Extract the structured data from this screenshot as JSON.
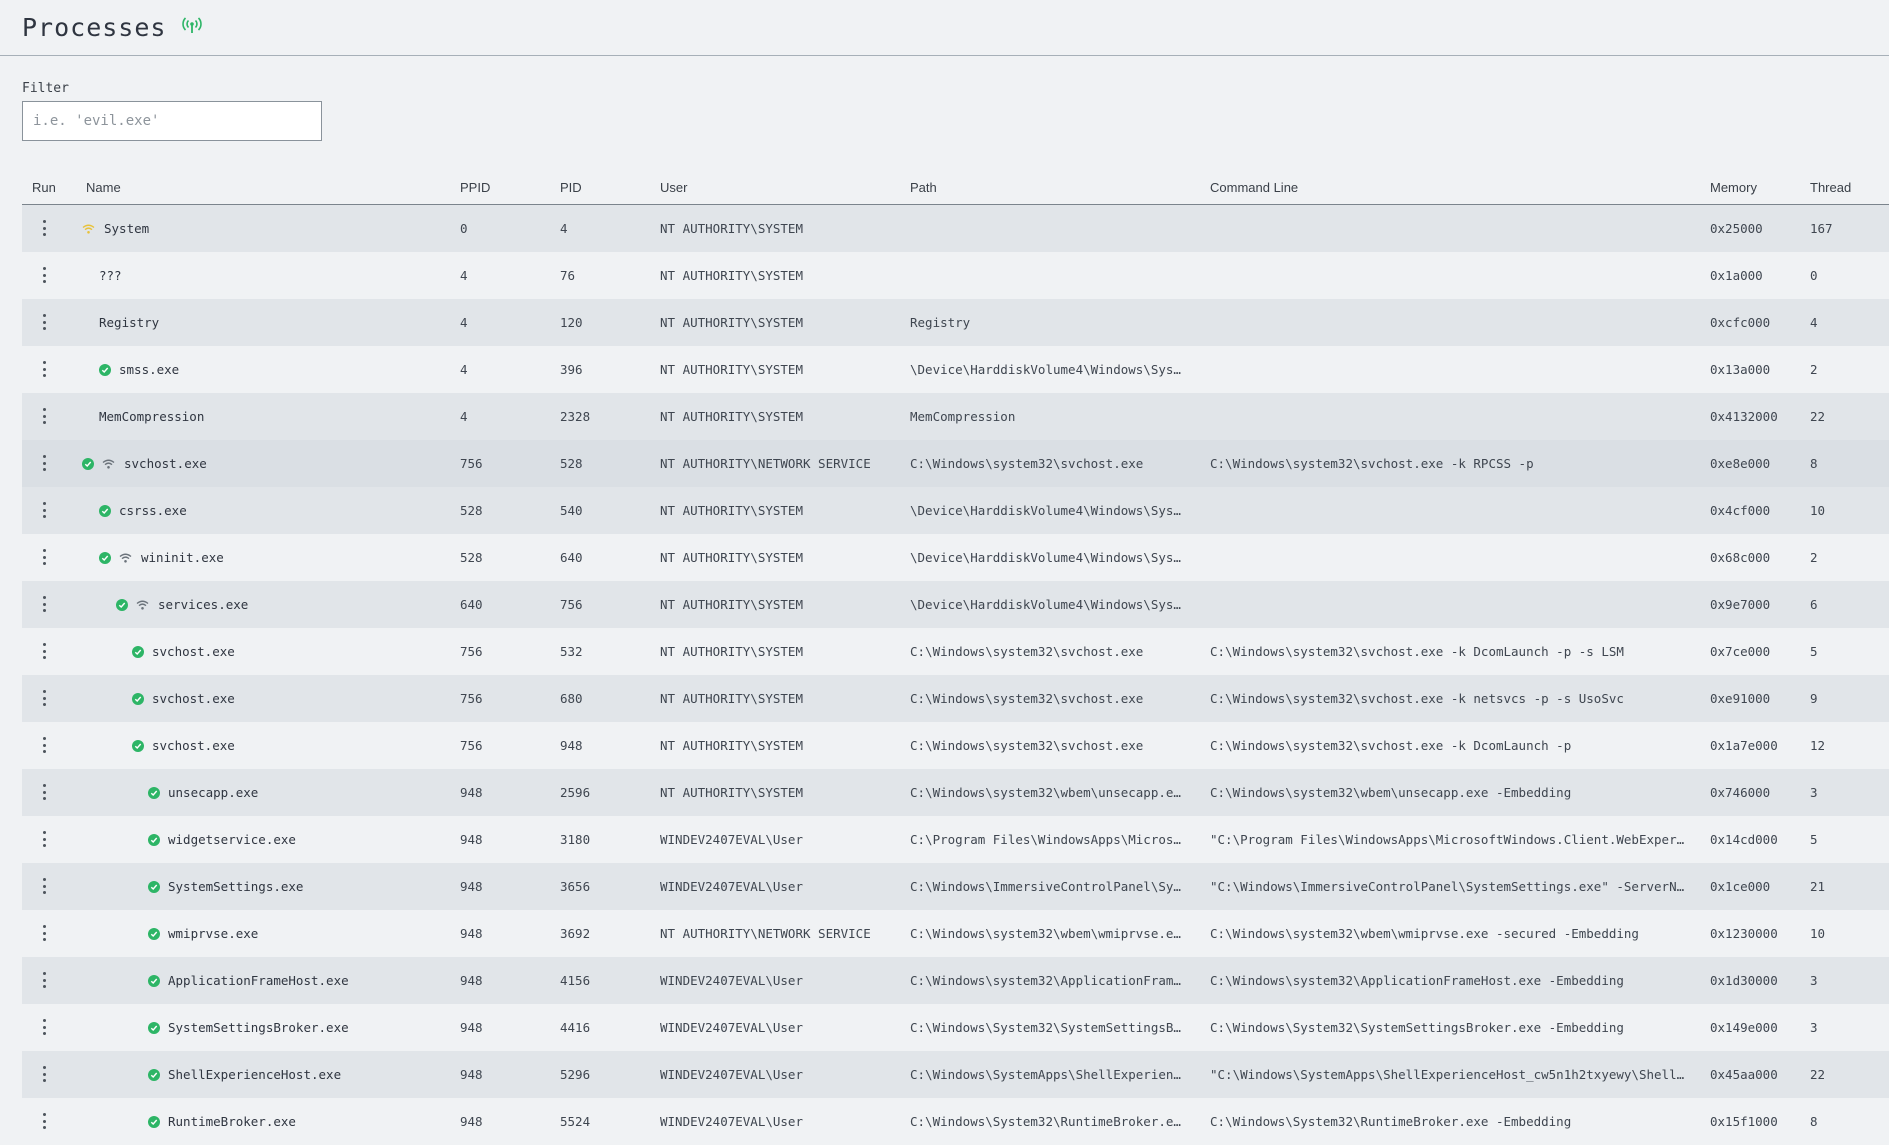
{
  "header": {
    "title": "Processes",
    "live_icon": "broadcast-icon",
    "accent": "#2db566"
  },
  "filter": {
    "label": "Filter",
    "placeholder": "i.e. 'evil.exe'",
    "value": ""
  },
  "table": {
    "columns": {
      "run": "Run",
      "name": "Name",
      "ppid": "PPID",
      "pid": "PID",
      "user": "User",
      "path": "Path",
      "cmd": "Command Line",
      "memory": "Memory",
      "thread": "Thread"
    },
    "rows": [
      {
        "name": "System",
        "level": 0,
        "check": false,
        "net": "yellow",
        "ppid": "0",
        "pid": "4",
        "user": "NT AUTHORITY\\SYSTEM",
        "path": "",
        "cmd": "",
        "memory": "0x25000",
        "thread": "167"
      },
      {
        "name": "???",
        "level": 1,
        "check": false,
        "net": null,
        "ppid": "4",
        "pid": "76",
        "user": "NT AUTHORITY\\SYSTEM",
        "path": "",
        "cmd": "",
        "memory": "0x1a000",
        "thread": "0"
      },
      {
        "name": "Registry",
        "level": 1,
        "check": false,
        "net": null,
        "ppid": "4",
        "pid": "120",
        "user": "NT AUTHORITY\\SYSTEM",
        "path": "Registry",
        "cmd": "",
        "memory": "0xcfc000",
        "thread": "4"
      },
      {
        "name": "smss.exe",
        "level": 1,
        "check": true,
        "net": null,
        "ppid": "4",
        "pid": "396",
        "user": "NT AUTHORITY\\SYSTEM",
        "path": "\\Device\\HarddiskVolume4\\Windows\\Sys…",
        "cmd": "",
        "memory": "0x13a000",
        "thread": "2"
      },
      {
        "name": "MemCompression",
        "level": 1,
        "check": false,
        "net": null,
        "ppid": "4",
        "pid": "2328",
        "user": "NT AUTHORITY\\SYSTEM",
        "path": "MemCompression",
        "cmd": "",
        "memory": "0x4132000",
        "thread": "22"
      },
      {
        "name": "svchost.exe",
        "level": 0,
        "check": true,
        "net": "gray",
        "selected": true,
        "ppid": "756",
        "pid": "528",
        "user": "NT AUTHORITY\\NETWORK SERVICE",
        "path": "C:\\Windows\\system32\\svchost.exe",
        "cmd": "C:\\Windows\\system32\\svchost.exe -k RPCSS -p",
        "memory": "0xe8e000",
        "thread": "8"
      },
      {
        "name": "csrss.exe",
        "level": 1,
        "check": true,
        "net": null,
        "ppid": "528",
        "pid": "540",
        "user": "NT AUTHORITY\\SYSTEM",
        "path": "\\Device\\HarddiskVolume4\\Windows\\Sys…",
        "cmd": "",
        "memory": "0x4cf000",
        "thread": "10"
      },
      {
        "name": "wininit.exe",
        "level": 1,
        "check": true,
        "net": "gray",
        "ppid": "528",
        "pid": "640",
        "user": "NT AUTHORITY\\SYSTEM",
        "path": "\\Device\\HarddiskVolume4\\Windows\\Sys…",
        "cmd": "",
        "memory": "0x68c000",
        "thread": "2"
      },
      {
        "name": "services.exe",
        "level": 2,
        "check": true,
        "net": "gray",
        "ppid": "640",
        "pid": "756",
        "user": "NT AUTHORITY\\SYSTEM",
        "path": "\\Device\\HarddiskVolume4\\Windows\\Sys…",
        "cmd": "",
        "memory": "0x9e7000",
        "thread": "6"
      },
      {
        "name": "svchost.exe",
        "level": 3,
        "check": true,
        "net": null,
        "ppid": "756",
        "pid": "532",
        "user": "NT AUTHORITY\\SYSTEM",
        "path": "C:\\Windows\\system32\\svchost.exe",
        "cmd": "C:\\Windows\\system32\\svchost.exe -k DcomLaunch -p -s LSM",
        "memory": "0x7ce000",
        "thread": "5"
      },
      {
        "name": "svchost.exe",
        "level": 3,
        "check": true,
        "net": null,
        "ppid": "756",
        "pid": "680",
        "user": "NT AUTHORITY\\SYSTEM",
        "path": "C:\\Windows\\system32\\svchost.exe",
        "cmd": "C:\\Windows\\system32\\svchost.exe -k netsvcs -p -s UsoSvc",
        "memory": "0xe91000",
        "thread": "9"
      },
      {
        "name": "svchost.exe",
        "level": 3,
        "check": true,
        "net": null,
        "ppid": "756",
        "pid": "948",
        "user": "NT AUTHORITY\\SYSTEM",
        "path": "C:\\Windows\\system32\\svchost.exe",
        "cmd": "C:\\Windows\\system32\\svchost.exe -k DcomLaunch -p",
        "memory": "0x1a7e000",
        "thread": "12"
      },
      {
        "name": "unsecapp.exe",
        "level": 4,
        "check": true,
        "net": null,
        "ppid": "948",
        "pid": "2596",
        "user": "NT AUTHORITY\\SYSTEM",
        "path": "C:\\Windows\\system32\\wbem\\unsecapp.e…",
        "cmd": "C:\\Windows\\system32\\wbem\\unsecapp.exe -Embedding",
        "memory": "0x746000",
        "thread": "3"
      },
      {
        "name": "widgetservice.exe",
        "level": 4,
        "check": true,
        "net": null,
        "ppid": "948",
        "pid": "3180",
        "user": "WINDEV2407EVAL\\User",
        "path": "C:\\Program Files\\WindowsApps\\Micros…",
        "cmd": "\"C:\\Program Files\\WindowsApps\\MicrosoftWindows.Client.WebExper…",
        "memory": "0x14cd000",
        "thread": "5"
      },
      {
        "name": "SystemSettings.exe",
        "level": 4,
        "check": true,
        "net": null,
        "ppid": "948",
        "pid": "3656",
        "user": "WINDEV2407EVAL\\User",
        "path": "C:\\Windows\\ImmersiveControlPanel\\Sy…",
        "cmd": "\"C:\\Windows\\ImmersiveControlPanel\\SystemSettings.exe\" -ServerN…",
        "memory": "0x1ce000",
        "thread": "21"
      },
      {
        "name": "wmiprvse.exe",
        "level": 4,
        "check": true,
        "net": null,
        "ppid": "948",
        "pid": "3692",
        "user": "NT AUTHORITY\\NETWORK SERVICE",
        "path": "C:\\Windows\\system32\\wbem\\wmiprvse.e…",
        "cmd": "C:\\Windows\\system32\\wbem\\wmiprvse.exe -secured -Embedding",
        "memory": "0x1230000",
        "thread": "10"
      },
      {
        "name": "ApplicationFrameHost.exe",
        "level": 4,
        "check": true,
        "net": null,
        "ppid": "948",
        "pid": "4156",
        "user": "WINDEV2407EVAL\\User",
        "path": "C:\\Windows\\system32\\ApplicationFram…",
        "cmd": "C:\\Windows\\system32\\ApplicationFrameHost.exe -Embedding",
        "memory": "0x1d30000",
        "thread": "3"
      },
      {
        "name": "SystemSettingsBroker.exe",
        "level": 4,
        "check": true,
        "net": null,
        "ppid": "948",
        "pid": "4416",
        "user": "WINDEV2407EVAL\\User",
        "path": "C:\\Windows\\System32\\SystemSettingsB…",
        "cmd": "C:\\Windows\\System32\\SystemSettingsBroker.exe -Embedding",
        "memory": "0x149e000",
        "thread": "3"
      },
      {
        "name": "ShellExperienceHost.exe",
        "level": 4,
        "check": true,
        "net": null,
        "ppid": "948",
        "pid": "5296",
        "user": "WINDEV2407EVAL\\User",
        "path": "C:\\Windows\\SystemApps\\ShellExperien…",
        "cmd": "\"C:\\Windows\\SystemApps\\ShellExperienceHost_cw5n1h2txyewy\\Shell…",
        "memory": "0x45aa000",
        "thread": "22"
      },
      {
        "name": "RuntimeBroker.exe",
        "level": 4,
        "check": true,
        "net": null,
        "ppid": "948",
        "pid": "5524",
        "user": "WINDEV2407EVAL\\User",
        "path": "C:\\Windows\\System32\\RuntimeBroker.e…",
        "cmd": "C:\\Windows\\System32\\RuntimeBroker.exe -Embedding",
        "memory": "0x15f1000",
        "thread": "8"
      }
    ]
  },
  "colors": {
    "check_green": "#2db566",
    "net_yellow": "#e8c23a",
    "net_gray": "#6b737b"
  }
}
